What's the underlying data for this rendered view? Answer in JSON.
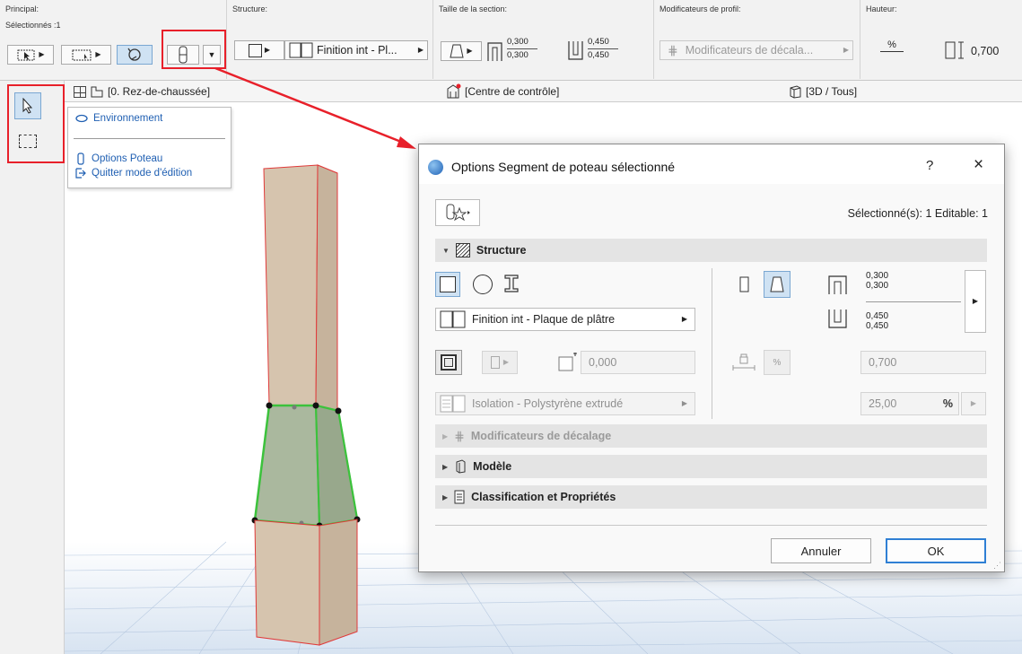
{
  "infobox": {
    "principal_title": "Principal:",
    "selected_label": "Sélectionnés :1",
    "structure_title": "Structure:",
    "structure_value": "Finition int - Pl...",
    "section_title": "Taille de la section:",
    "section_top_a": "0,300",
    "section_top_b": "0,300",
    "section_bot_a": "0,450",
    "section_bot_b": "0,450",
    "modifiers_title": "Modificateurs de profil:",
    "modifiers_value": "Modificateurs de décala...",
    "height_title": "Hauteur:",
    "height_value": "0,700",
    "percent_symbol": "%"
  },
  "tabs": {
    "floor_plan": "[0. Rez-de-chaussée]",
    "control_center": "[Centre de contrôle]",
    "view_3d": "[3D / Tous]"
  },
  "popmenu": {
    "environment": "Environnement",
    "column_options": "Options Poteau",
    "exit_edit": "Quitter mode d'édition"
  },
  "dialog": {
    "title": "Options Segment de poteau sélectionné",
    "help": "?",
    "close": "×",
    "selection_info": "Sélectionné(s): 1 Editable: 1",
    "structure_section": "Structure",
    "building_material": "Finition int - Plaque de plâtre",
    "offset_value": "0,000",
    "insulation_material": "Isolation - Polystyrène extrudé",
    "top_dim_a": "0,300",
    "top_dim_b": "0,300",
    "bottom_dim_a": "0,450",
    "bottom_dim_b": "0,450",
    "height_value": "0,700",
    "percent_value": "25,00",
    "percent_symbol": "%",
    "offset_modifiers_section": "Modificateurs de décalage",
    "model_section": "Modèle",
    "classification_section": "Classification et Propriétés",
    "cancel": "Annuler",
    "ok": "OK"
  },
  "colors": {
    "annotation_red": "#e8202a",
    "selection_green": "#3cc23c",
    "column_fill": "#d4c2ad",
    "column_edge": "#e03a3a",
    "accent_blue": "#2f7fd4"
  }
}
